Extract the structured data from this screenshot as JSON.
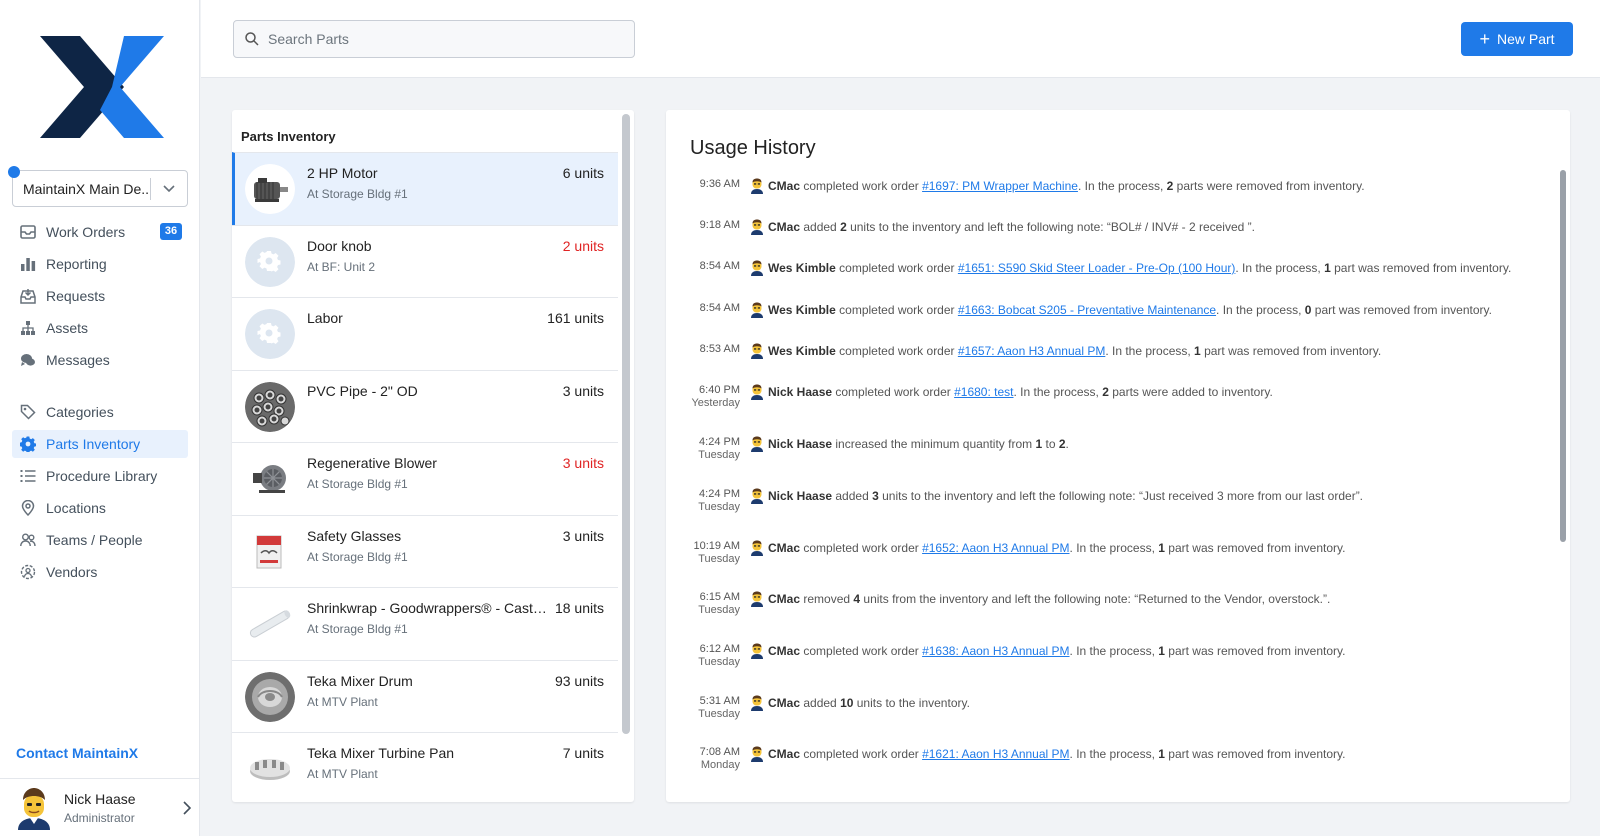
{
  "sidebar": {
    "org_name": "MaintainX Main De...",
    "nav": [
      {
        "label": "Work Orders",
        "icon": "inbox-icon",
        "badge": "36",
        "active": false
      },
      {
        "label": "Reporting",
        "icon": "bar-chart-icon",
        "active": false
      },
      {
        "label": "Requests",
        "icon": "tray-icon",
        "active": false
      },
      {
        "label": "Assets",
        "icon": "hierarchy-icon",
        "active": false
      },
      {
        "label": "Messages",
        "icon": "chat-bubbles-icon",
        "active": false
      },
      {
        "label": "Categories",
        "icon": "tag-icon",
        "active": false
      },
      {
        "label": "Parts Inventory",
        "icon": "gear-icon",
        "active": true
      },
      {
        "label": "Procedure Library",
        "icon": "list-icon",
        "active": false
      },
      {
        "label": "Locations",
        "icon": "location-pin-icon",
        "active": false
      },
      {
        "label": "Teams / People",
        "icon": "people-icon",
        "active": false
      },
      {
        "label": "Vendors",
        "icon": "vendors-icon",
        "active": false
      }
    ],
    "contact": "Contact MaintainX",
    "user": {
      "name": "Nick Haase",
      "role": "Administrator"
    }
  },
  "topbar": {
    "search_placeholder": "Search Parts",
    "new_button": "New Part"
  },
  "colors": {
    "accent": "#1f7ae8",
    "low_stock": "#e02424",
    "selected_bg": "#e8f1fd"
  },
  "parts": {
    "title": "Parts Inventory",
    "items": [
      {
        "name": "2 HP Motor",
        "location": "At Storage Bldg #1",
        "qty": "6 units",
        "low": false,
        "selected": true,
        "thumb": "motor"
      },
      {
        "name": "Door knob",
        "location": "At BF: Unit 2",
        "qty": "2 units",
        "low": true,
        "selected": false,
        "thumb": "placeholder"
      },
      {
        "name": "Labor",
        "location": "",
        "qty": "161 units",
        "low": false,
        "selected": false,
        "thumb": "placeholder"
      },
      {
        "name": "PVC Pipe - 2\" OD",
        "location": "",
        "qty": "3 units",
        "low": false,
        "selected": false,
        "thumb": "pipes"
      },
      {
        "name": "Regenerative Blower",
        "location": "At Storage Bldg #1",
        "qty": "3 units",
        "low": true,
        "selected": false,
        "thumb": "blower"
      },
      {
        "name": "Safety Glasses",
        "location": "At Storage Bldg #1",
        "qty": "3 units",
        "low": false,
        "selected": false,
        "thumb": "glasses"
      },
      {
        "name": "Shrinkwrap - Goodwrappers® - Cast,...",
        "location": "At Storage Bldg #1",
        "qty": "18 units",
        "low": false,
        "selected": false,
        "thumb": "wrap"
      },
      {
        "name": "Teka Mixer Drum",
        "location": "At MTV Plant",
        "qty": "93 units",
        "low": false,
        "selected": false,
        "thumb": "drum"
      },
      {
        "name": "Teka Mixer Turbine Pan",
        "location": "At MTV Plant",
        "qty": "7 units",
        "low": false,
        "selected": false,
        "thumb": "pan"
      }
    ]
  },
  "usage": {
    "title": "Usage History",
    "entries": [
      {
        "time": "9:36 AM",
        "day": "",
        "html": "<b>CMac</b> completed work order <a>#1697: PM Wrapper Machine</a>. In the process, <b>2</b> parts were removed from inventory."
      },
      {
        "time": "9:18 AM",
        "day": "",
        "html": "<b>CMac</b> added <b>2</b> units to the inventory and left the following note: “BOL# / INV# - 2 received ”."
      },
      {
        "time": "8:54 AM",
        "day": "",
        "html": "<b>Wes Kimble</b> completed work order <a>#1651: S590 Skid Steer Loader - Pre-Op (100 Hour)</a>. In the process, <b>1</b> part was removed from inventory."
      },
      {
        "time": "8:54 AM",
        "day": "",
        "html": "<b>Wes Kimble</b> completed work order <a>#1663: Bobcat S205 - Preventative Maintenance</a>. In the process, <b>0</b> part was removed from inventory."
      },
      {
        "time": "8:53 AM",
        "day": "",
        "html": "<b>Wes Kimble</b> completed work order <a>#1657: Aaon H3 Annual PM</a>. In the process, <b>1</b> part was removed from inventory."
      },
      {
        "time": "6:40 PM",
        "day": "Yesterday",
        "html": "<b>Nick Haase</b> completed work order <a>#1680: test</a>. In the process, <b>2</b> parts were added to inventory."
      },
      {
        "time": "4:24 PM",
        "day": "Tuesday",
        "html": "<b>Nick Haase</b> increased the minimum quantity from <b>1</b> to <b>2</b>."
      },
      {
        "time": "4:24 PM",
        "day": "Tuesday",
        "html": "<b>Nick Haase</b> added <b>3</b> units to the inventory and left the following note: “Just received 3 more from our last order”."
      },
      {
        "time": "10:19 AM",
        "day": "Tuesday",
        "html": "<b>CMac</b> completed work order <a>#1652: Aaon H3 Annual PM</a>. In the process, <b>1</b> part was removed from inventory."
      },
      {
        "time": "6:15 AM",
        "day": "Tuesday",
        "html": "<b>CMac</b> removed <b>4</b> units from the inventory and left the following note: “Returned to the Vendor, overstock.”."
      },
      {
        "time": "6:12 AM",
        "day": "Tuesday",
        "html": "<b>CMac</b> completed work order <a>#1638: Aaon H3 Annual PM</a>. In the process, <b>1</b> part was removed from inventory."
      },
      {
        "time": "5:31 AM",
        "day": "Tuesday",
        "html": "<b>CMac</b> added <b>10</b> units to the inventory."
      },
      {
        "time": "7:08 AM",
        "day": "Monday",
        "html": "<b>CMac</b> completed work order <a>#1621: Aaon H3 Annual PM</a>. In the process, <b>1</b> part was removed from inventory."
      }
    ]
  }
}
